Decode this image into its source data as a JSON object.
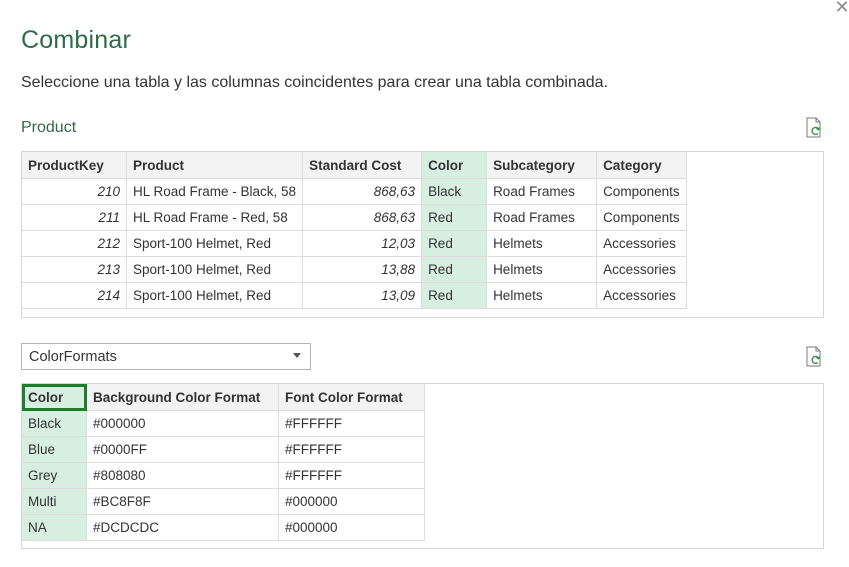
{
  "dialog": {
    "title": "Combinar",
    "subtitle": "Seleccione una tabla y las columnas coincidentes para crear una tabla combinada.",
    "close_glyph": "✕"
  },
  "top": {
    "label": "Product",
    "columns": [
      "ProductKey",
      "Product",
      "Standard Cost",
      "Color",
      "Subcategory",
      "Category"
    ],
    "rows": [
      [
        "210",
        "HL Road Frame - Black, 58",
        "868,63",
        "Black",
        "Road Frames",
        "Components"
      ],
      [
        "211",
        "HL Road Frame - Red, 58",
        "868,63",
        "Red",
        "Road Frames",
        "Components"
      ],
      [
        "212",
        "Sport-100 Helmet, Red",
        "12,03",
        "Red",
        "Helmets",
        "Accessories"
      ],
      [
        "213",
        "Sport-100 Helmet, Red",
        "13,88",
        "Red",
        "Helmets",
        "Accessories"
      ],
      [
        "214",
        "Sport-100 Helmet, Red",
        "13,09",
        "Red",
        "Helmets",
        "Accessories"
      ]
    ],
    "selected_column": "Color"
  },
  "bottom": {
    "select_value": "ColorFormats",
    "columns": [
      "Color",
      "Background Color Format",
      "Font Color Format"
    ],
    "rows": [
      [
        "Black",
        "#000000",
        "#FFFFFF"
      ],
      [
        "Blue",
        "#0000FF",
        "#FFFFFF"
      ],
      [
        "Grey",
        "#808080",
        "#FFFFFF"
      ],
      [
        "Multi",
        "#BC8F8F",
        "#000000"
      ],
      [
        "NA",
        "#DCDCDC",
        "#000000"
      ]
    ],
    "selected_column": "Color"
  },
  "icons": {
    "refresh": "refresh-document-icon",
    "dropdown": "chevron-down-icon",
    "close": "close-icon"
  },
  "colors": {
    "accent": "#2f6b4a",
    "selected_column_bg": "#d6efe0",
    "selection_outline": "#1e7e2d"
  }
}
